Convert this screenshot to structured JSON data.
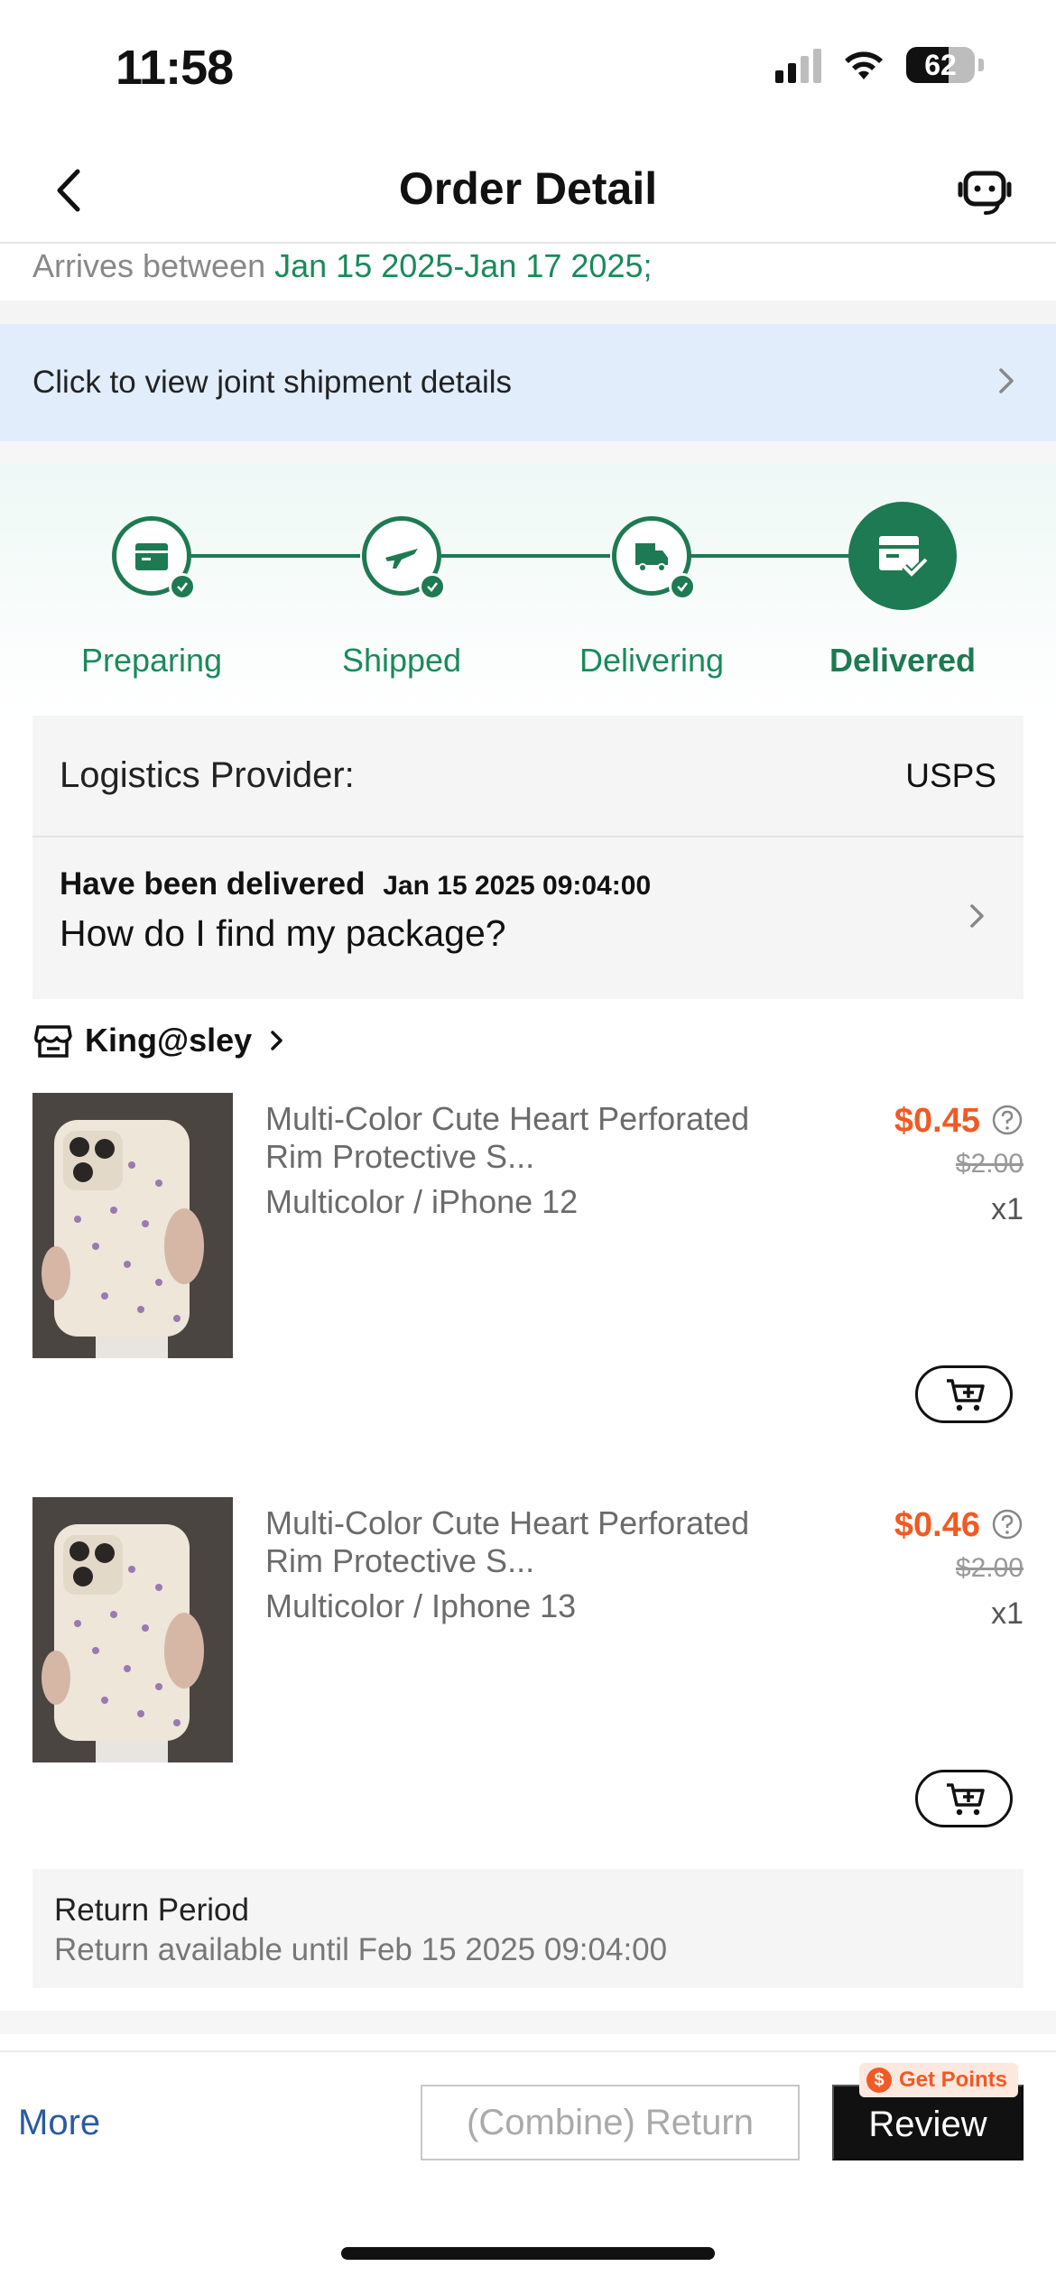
{
  "status_bar": {
    "time": "11:58",
    "battery": "62",
    "battery_level": 0.62
  },
  "header": {
    "title": "Order Detail"
  },
  "arrival": {
    "prefix": "Arrives between",
    "dates": "Jan 15 2025-Jan 17 2025;"
  },
  "joint_shipment": {
    "label": "Click to view joint shipment details"
  },
  "progress": {
    "steps": [
      {
        "label": "Preparing",
        "icon": "box-icon",
        "done": true
      },
      {
        "label": "Shipped",
        "icon": "plane-icon",
        "done": true
      },
      {
        "label": "Delivering",
        "icon": "truck-icon",
        "done": true
      },
      {
        "label": "Delivered",
        "icon": "delivered-icon",
        "active": true
      }
    ],
    "accent_color": "#1d7a52"
  },
  "logistics": {
    "provider_label": "Logistics Provider:",
    "provider_value": "USPS",
    "status": "Have been delivered",
    "status_time": "Jan 15 2025 09:04:00",
    "help_link": "How do I find my package?"
  },
  "store": {
    "name": "King@sley"
  },
  "products": [
    {
      "title": "Multi-Color Cute Heart Perforated Rim Protective S...",
      "variant": "Multicolor / iPhone 12",
      "price": "$0.45",
      "original_price": "$2.00",
      "quantity": "x1"
    },
    {
      "title": "Multi-Color Cute Heart Perforated Rim Protective S...",
      "variant": "Multicolor / Iphone 13",
      "price": "$0.46",
      "original_price": "$2.00",
      "quantity": "x1"
    }
  ],
  "return_period": {
    "title": "Return Period",
    "detail": "Return available until Feb 15 2025 09:04:00"
  },
  "bottom_bar": {
    "more": "More",
    "return_button": "(Combine) Return",
    "review_button": "Review",
    "points_badge": "Get Points",
    "points_coin": "$"
  },
  "colors": {
    "price": "#f05a24",
    "accent": "#1d7a52",
    "link": "#2c5aa0",
    "banner": "#e2edfc"
  }
}
